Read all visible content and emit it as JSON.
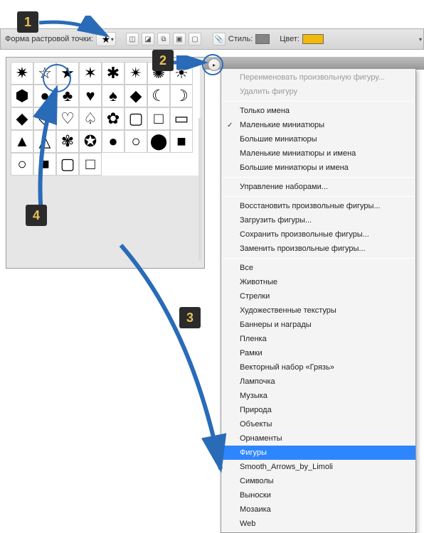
{
  "toolbar": {
    "shape_label": "Форма растровой точки:",
    "style_label": "Стиль:",
    "color_label": "Цвет:",
    "style_color": "#848484",
    "fill_color": "#f2b90c"
  },
  "badges": {
    "b1": "1",
    "b2": "2",
    "b3": "3",
    "b4": "4"
  },
  "shapes_grid": [
    "starburst10",
    "star5-outline",
    "star5",
    "star6",
    "star6-concave",
    "star8",
    "seal",
    "sunburst",
    "hexagon",
    "blob",
    "club",
    "heart",
    "spade",
    "diamond-rounded",
    "moon",
    "moon-filled",
    "diamond",
    "diamond-outline",
    "heart-outline",
    "spade-outline",
    "flower",
    "square-rounded",
    "square-outline",
    "frame",
    "triangle",
    "triangle-outline",
    "amoeba",
    "star-rounded",
    "circle",
    "circle-outline",
    "disc",
    "square-solid"
  ],
  "shapes_row2": [
    "circle-outline-big",
    "square-solid-big",
    "square-border",
    "square-empty"
  ],
  "menu": {
    "items": [
      {
        "label": "Переименовать произвольную фигуру...",
        "disabled": true
      },
      {
        "label": "Удалить фигуру",
        "disabled": true
      },
      {
        "sep": true
      },
      {
        "label": "Только имена"
      },
      {
        "label": "Маленькие миниатюры",
        "checked": true
      },
      {
        "label": "Большие миниатюры"
      },
      {
        "label": "Маленькие миниатюры и имена"
      },
      {
        "label": "Большие миниатюры и имена"
      },
      {
        "sep": true
      },
      {
        "label": "Управление наборами..."
      },
      {
        "sep": true
      },
      {
        "label": "Восстановить произвольные фигуры..."
      },
      {
        "label": "Загрузить фигуры..."
      },
      {
        "label": "Сохранить произвольные фигуры..."
      },
      {
        "label": "Заменить произвольные фигуры..."
      },
      {
        "sep": true
      },
      {
        "label": "Все"
      },
      {
        "label": "Животные"
      },
      {
        "label": "Стрелки"
      },
      {
        "label": "Художественные текстуры"
      },
      {
        "label": "Баннеры и награды"
      },
      {
        "label": "Пленка"
      },
      {
        "label": "Рамки"
      },
      {
        "label": "Векторный набор «Грязь»"
      },
      {
        "label": "Лампочка"
      },
      {
        "label": "Музыка"
      },
      {
        "label": "Природа"
      },
      {
        "label": "Объекты"
      },
      {
        "label": "Орнаменты"
      },
      {
        "label": "Фигуры",
        "selected": true
      },
      {
        "label": "Smooth_Arrows_by_Limoli"
      },
      {
        "label": "Символы"
      },
      {
        "label": "Выноски"
      },
      {
        "label": "Мозаика"
      },
      {
        "label": "Web"
      }
    ]
  }
}
